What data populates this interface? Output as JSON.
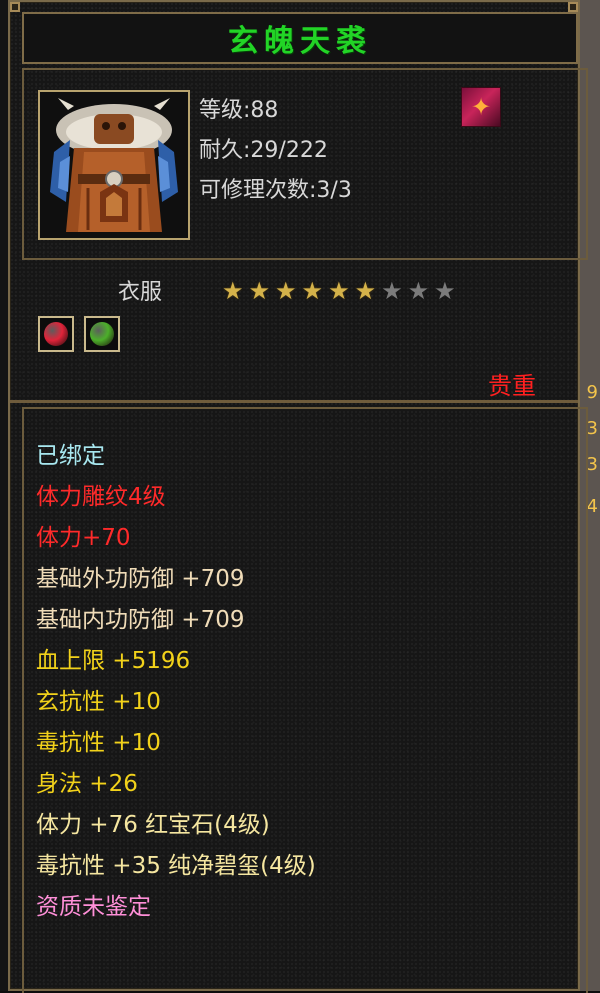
{
  "title": "玄魄天裘",
  "item": {
    "level_label": "等级:88",
    "durability_label": "耐久:29/222",
    "repair_label": "可修理次数:3/3",
    "category": "衣服",
    "stars_total": 9,
    "stars_filled": 6,
    "rarity": "贵重"
  },
  "sockets": [
    {
      "name": "ruby-socket-icon",
      "color": "#e0243a"
    },
    {
      "name": "jade-socket-icon",
      "color": "#4caf2a"
    }
  ],
  "attributes": [
    {
      "text": "已绑定",
      "color": "#a8e8f0"
    },
    {
      "text": "体力雕纹4级",
      "color": "#ff2a2a"
    },
    {
      "text": "体力+70",
      "color": "#ff2a2a"
    },
    {
      "text": "基础外功防御 +709",
      "color": "#f0dcb8"
    },
    {
      "text": "基础内功防御 +709",
      "color": "#f0dcb8"
    },
    {
      "text": "血上限 +5196",
      "color": "#f2d21a"
    },
    {
      "text": "玄抗性 +10",
      "color": "#f2d21a"
    },
    {
      "text": "毒抗性 +10",
      "color": "#f2d21a"
    },
    {
      "text": "身法 +26",
      "color": "#f2d21a"
    },
    {
      "text": "体力 +76 红宝石(4级)",
      "color": "#f5e6a0"
    },
    {
      "text": "毒抗性 +35 纯净碧玺(4级)",
      "color": "#f5e6a0"
    },
    {
      "text": "资质未鉴定",
      "color": "#ff8fd8"
    }
  ],
  "background_glyphs": [
    "9",
    "3",
    "3",
    "4"
  ]
}
